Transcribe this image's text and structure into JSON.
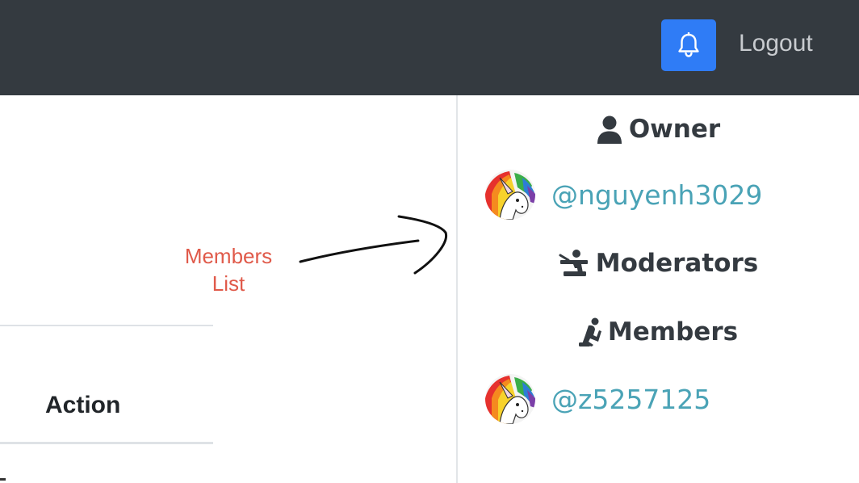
{
  "navbar": {
    "notifications_icon": "bell-icon",
    "logout_label": "Logout",
    "bell_button_color": "#2f7cf6"
  },
  "annotation": {
    "line1": "Members",
    "line2": "List",
    "color": "#e05a4a"
  },
  "table": {
    "action_header": "Action"
  },
  "members_panel": {
    "owner": {
      "heading": "Owner",
      "icon": "user-icon",
      "users": [
        {
          "username": "@nguyenh3029",
          "avatar": "unicorn-avatar"
        }
      ]
    },
    "moderators": {
      "heading": "Moderators",
      "icon": "chalkboard-teacher-icon",
      "users": []
    },
    "members": {
      "heading": "Members",
      "icon": "kneeling-person-icon",
      "users": [
        {
          "username": "@z5257125",
          "avatar": "unicorn-avatar"
        }
      ]
    },
    "link_color": "#4aa3b6"
  }
}
